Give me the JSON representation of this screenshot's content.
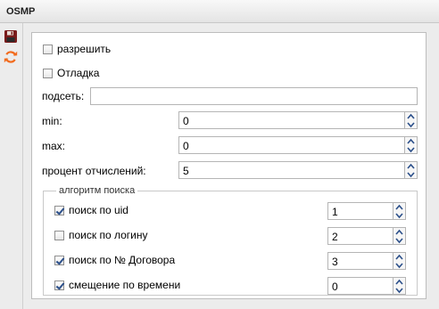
{
  "window": {
    "title": "OSMP"
  },
  "toolbar": {
    "save_icon": "save-icon",
    "refresh_icon": "refresh-icon",
    "refresh_color": "#f26b1d"
  },
  "form": {
    "enable": {
      "label": "разрешить",
      "checked": false
    },
    "debug": {
      "label": "Отладка",
      "checked": false
    },
    "subnet": {
      "label": "подсеть:",
      "value": ""
    },
    "min": {
      "label": "min:",
      "value": "0"
    },
    "max": {
      "label": "max:",
      "value": "0"
    },
    "percent": {
      "label": "процент отчислений:",
      "value": "5"
    }
  },
  "search": {
    "legend": "алгоритм поиска",
    "items": [
      {
        "label": "поиск по uid",
        "checked": true,
        "value": "1"
      },
      {
        "label": "поиск по логину",
        "checked": false,
        "value": "2"
      },
      {
        "label": "поиск по № Договора",
        "checked": true,
        "value": "3"
      },
      {
        "label": "смещение по времени",
        "checked": true,
        "value": "0"
      }
    ]
  }
}
